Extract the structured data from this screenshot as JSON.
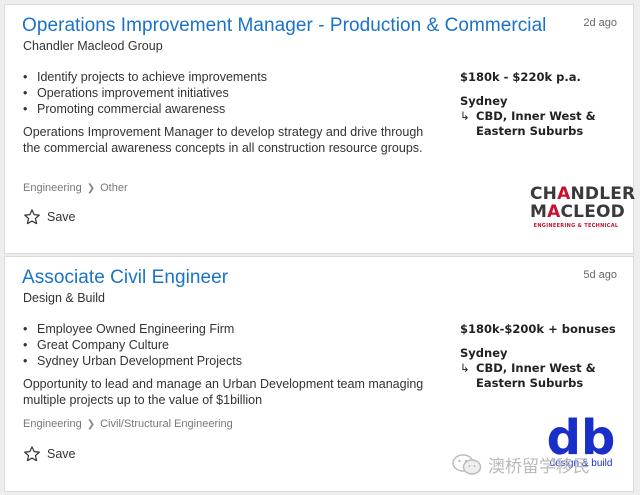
{
  "jobs": [
    {
      "title": "Operations Improvement Manager - Production & Commercial",
      "company": "Chandler Macleod Group",
      "age": "2d ago",
      "bullets": [
        "Identify projects to achieve improvements",
        "Operations improvement initiatives",
        "Promoting commercial awareness"
      ],
      "description": "Operations Improvement Manager to develop strategy and drive through the commercial awareness concepts in all construction resource groups.",
      "category": "Engineering",
      "subcategory": "Other",
      "save_label": "Save",
      "salary": "$180k - $220k p.a.",
      "location": "Sydney",
      "area": "CBD, Inner West & Eastern Suburbs",
      "logo": {
        "line1": "CHANDLER",
        "line2": "MACLEOD",
        "line3": "ENGINEERING & TECHNICAL"
      }
    },
    {
      "title": "Associate Civil Engineer",
      "company": "Design & Build",
      "age": "5d ago",
      "bullets": [
        "Employee Owned Engineering Firm",
        "Great Company Culture",
        "Sydney Urban Development Projects"
      ],
      "description": "Opportunity to lead and manage an Urban Development team managing multiple projects up to the value of $1billion",
      "category": "Engineering",
      "subcategory": "Civil/Structural Engineering",
      "save_label": "Save",
      "salary": "$180k-$200k + bonuses",
      "location": "Sydney",
      "area": "CBD, Inner West & Eastern Suburbs",
      "logo": {
        "mark": "db",
        "tagline": "design & build"
      }
    }
  ],
  "watermark": "澳桥留学移民",
  "colors": {
    "title": "#1a73c8",
    "logo_red": "#c8102e",
    "logo_blue": "#1a2fc8"
  },
  "icons": {
    "save": "star-outline-icon",
    "breadcrumb_separator": "chevron-right-icon",
    "location_sub": "return-arrow-icon",
    "watermark": "wechat-icon"
  }
}
